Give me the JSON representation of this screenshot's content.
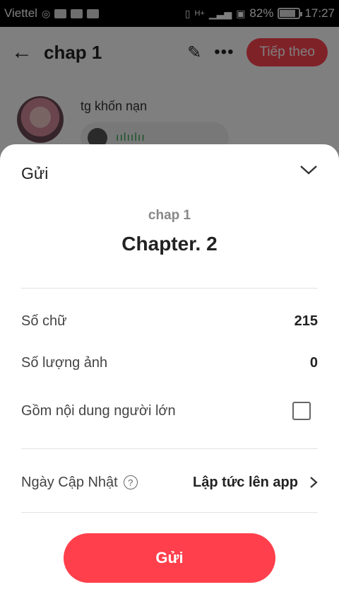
{
  "status_bar": {
    "carrier": "Viettel",
    "network": "H+",
    "battery": "82%",
    "battery_level": 0.82,
    "time": "17:27"
  },
  "header": {
    "title": "chap 1",
    "next_button": "Tiếp theo"
  },
  "author": {
    "name": "tg khốn nạn"
  },
  "sheet": {
    "title": "Gửi",
    "chap_name": "chap 1",
    "chapter_heading": "Chapter. 2",
    "word_count_label": "Số chữ",
    "word_count_value": "215",
    "image_count_label": "Số lượng ảnh",
    "image_count_value": "0",
    "adult_content_label": "Gồm nội dung người lớn",
    "adult_content_checked": false,
    "update_date_label": "Ngày Cập Nhật",
    "update_date_value": "Lập tức lên app",
    "submit_button": "Gửi"
  },
  "colors": {
    "accent": "#ff3f4b",
    "overlay": "#000000"
  }
}
